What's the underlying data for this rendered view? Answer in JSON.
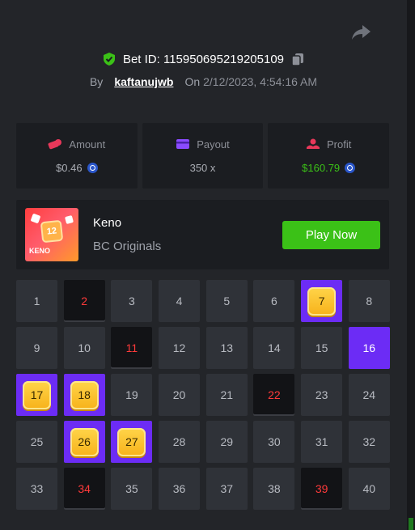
{
  "bet": {
    "id_label": "Bet ID: 115950695219205109",
    "by_label": "By",
    "username": "kaftanujwb",
    "on_label": "On",
    "date": "2/12/2023, 4:54:16 AM"
  },
  "stats": {
    "amount": {
      "label": "Amount",
      "value": "$0.46"
    },
    "payout": {
      "label": "Payout",
      "value": "350 x"
    },
    "profit": {
      "label": "Profit",
      "value": "$160.79"
    }
  },
  "game": {
    "name": "Keno",
    "provider": "BC Originals",
    "thumb_number": "12",
    "thumb_label": "KENO",
    "play_label": "Play Now"
  },
  "grid": {
    "tiles": [
      {
        "n": "1",
        "state": "normal"
      },
      {
        "n": "2",
        "state": "drawn"
      },
      {
        "n": "3",
        "state": "normal"
      },
      {
        "n": "4",
        "state": "normal"
      },
      {
        "n": "5",
        "state": "normal"
      },
      {
        "n": "6",
        "state": "normal"
      },
      {
        "n": "7",
        "state": "hit"
      },
      {
        "n": "8",
        "state": "normal"
      },
      {
        "n": "9",
        "state": "normal"
      },
      {
        "n": "10",
        "state": "normal"
      },
      {
        "n": "11",
        "state": "drawn"
      },
      {
        "n": "12",
        "state": "normal"
      },
      {
        "n": "13",
        "state": "normal"
      },
      {
        "n": "14",
        "state": "normal"
      },
      {
        "n": "15",
        "state": "normal"
      },
      {
        "n": "16",
        "state": "picked"
      },
      {
        "n": "17",
        "state": "hit"
      },
      {
        "n": "18",
        "state": "hit"
      },
      {
        "n": "19",
        "state": "normal"
      },
      {
        "n": "20",
        "state": "normal"
      },
      {
        "n": "21",
        "state": "normal"
      },
      {
        "n": "22",
        "state": "drawn"
      },
      {
        "n": "23",
        "state": "normal"
      },
      {
        "n": "24",
        "state": "normal"
      },
      {
        "n": "25",
        "state": "normal"
      },
      {
        "n": "26",
        "state": "hit"
      },
      {
        "n": "27",
        "state": "hit"
      },
      {
        "n": "28",
        "state": "normal"
      },
      {
        "n": "29",
        "state": "normal"
      },
      {
        "n": "30",
        "state": "normal"
      },
      {
        "n": "31",
        "state": "normal"
      },
      {
        "n": "32",
        "state": "normal"
      },
      {
        "n": "33",
        "state": "normal"
      },
      {
        "n": "34",
        "state": "drawn"
      },
      {
        "n": "35",
        "state": "normal"
      },
      {
        "n": "36",
        "state": "normal"
      },
      {
        "n": "37",
        "state": "normal"
      },
      {
        "n": "38",
        "state": "normal"
      },
      {
        "n": "39",
        "state": "drawn"
      },
      {
        "n": "40",
        "state": "normal"
      }
    ]
  },
  "footer": {
    "partial_text": ""
  },
  "icons": {
    "share": "share-icon",
    "verified": "shield-check-icon",
    "copy": "copy-icon",
    "amount": "chips-icon",
    "payout": "card-icon",
    "profit": "profit-icon",
    "currency": "coin-icon"
  },
  "colors": {
    "accent_green": "#3bc117",
    "accent_purple": "#6c2cf5",
    "drawn_red": "#ff3a3a",
    "gem_gold": "#f7b21a"
  }
}
